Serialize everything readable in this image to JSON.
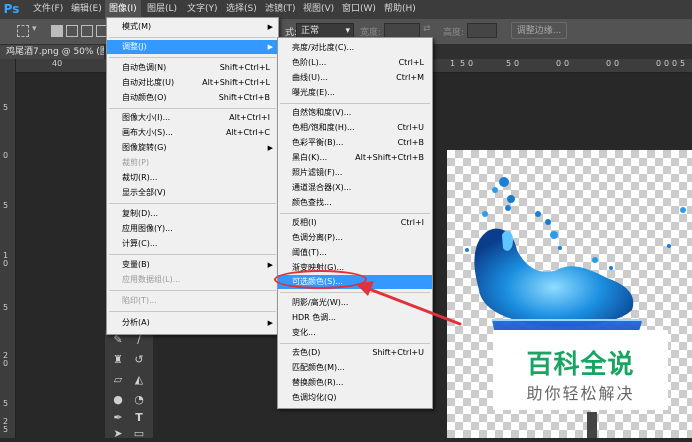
{
  "menubar": {
    "logo": "Ps",
    "items": [
      "文件(F)",
      "编辑(E)",
      "图像(I)",
      "图层(L)",
      "文字(Y)",
      "选择(S)",
      "滤镜(T)",
      "视图(V)",
      "窗口(W)",
      "帮助(H)"
    ]
  },
  "options": {
    "mode_label": "式:",
    "mode_value": "正常",
    "width_label": "宽度:",
    "height_label": "高度:",
    "refine_label": "调整边缘..."
  },
  "document": {
    "tab_title": "鸡尾酒7.png @ 50% (图层",
    "hruler_ticks": [
      "40",
      "1",
      "5",
      "0",
      "1",
      "5",
      "0",
      "5",
      "0",
      "0",
      "0",
      "0",
      "0",
      "0",
      "0",
      "0",
      "5"
    ],
    "vruler_ticks": [
      "5",
      "0",
      "5",
      "1",
      "0",
      "5",
      "2",
      "0",
      "5",
      "2",
      "5"
    ]
  },
  "image_menu": {
    "items": [
      {
        "label": "模式(M)",
        "shortcut": "",
        "arrow": true
      },
      {
        "label": "调整(J)",
        "shortcut": "",
        "arrow": true
      },
      {
        "label": "自动色调(N)",
        "shortcut": "Shift+Ctrl+L",
        "arrow": false
      },
      {
        "label": "自动对比度(U)",
        "shortcut": "Alt+Shift+Ctrl+L",
        "arrow": false
      },
      {
        "label": "自动颜色(O)",
        "shortcut": "Shift+Ctrl+B",
        "arrow": false
      },
      {
        "label": "图像大小(I)...",
        "shortcut": "Alt+Ctrl+I",
        "arrow": false
      },
      {
        "label": "画布大小(S)...",
        "shortcut": "Alt+Ctrl+C",
        "arrow": false
      },
      {
        "label": "图像旋转(G)",
        "shortcut": "",
        "arrow": true
      },
      {
        "label": "裁剪(P)",
        "shortcut": "",
        "arrow": false
      },
      {
        "label": "裁切(R)...",
        "shortcut": "",
        "arrow": false
      },
      {
        "label": "显示全部(V)",
        "shortcut": "",
        "arrow": false
      },
      {
        "label": "复制(D)...",
        "shortcut": "",
        "arrow": false
      },
      {
        "label": "应用图像(Y)...",
        "shortcut": "",
        "arrow": false
      },
      {
        "label": "计算(C)...",
        "shortcut": "",
        "arrow": false
      },
      {
        "label": "变量(B)",
        "shortcut": "",
        "arrow": true
      },
      {
        "label": "应用数据组(L)...",
        "shortcut": "",
        "arrow": false
      },
      {
        "label": "陷印(T)...",
        "shortcut": "",
        "arrow": false
      },
      {
        "label": "分析(A)",
        "shortcut": "",
        "arrow": true
      }
    ]
  },
  "adjust_menu": {
    "items": [
      {
        "label": "亮度/对比度(C)...",
        "shortcut": ""
      },
      {
        "label": "色阶(L)...",
        "shortcut": "Ctrl+L"
      },
      {
        "label": "曲线(U)...",
        "shortcut": "Ctrl+M"
      },
      {
        "label": "曝光度(E)...",
        "shortcut": ""
      },
      {
        "label": "自然饱和度(V)...",
        "shortcut": ""
      },
      {
        "label": "色相/饱和度(H)...",
        "shortcut": "Ctrl+U"
      },
      {
        "label": "色彩平衡(B)...",
        "shortcut": "Ctrl+B"
      },
      {
        "label": "黑白(K)...",
        "shortcut": "Alt+Shift+Ctrl+B"
      },
      {
        "label": "照片滤镜(F)...",
        "shortcut": ""
      },
      {
        "label": "通道混合器(X)...",
        "shortcut": ""
      },
      {
        "label": "颜色查找...",
        "shortcut": ""
      },
      {
        "label": "反相(I)",
        "shortcut": "Ctrl+I"
      },
      {
        "label": "色调分离(P)...",
        "shortcut": ""
      },
      {
        "label": "阈值(T)...",
        "shortcut": ""
      },
      {
        "label": "渐变映射(G)...",
        "shortcut": ""
      },
      {
        "label": "可选颜色(S)...",
        "shortcut": ""
      },
      {
        "label": "阴影/高光(W)...",
        "shortcut": ""
      },
      {
        "label": "HDR 色调...",
        "shortcut": ""
      },
      {
        "label": "变化...",
        "shortcut": ""
      },
      {
        "label": "去色(D)",
        "shortcut": "Shift+Ctrl+U"
      },
      {
        "label": "匹配颜色(M)...",
        "shortcut": ""
      },
      {
        "label": "替换颜色(R)...",
        "shortcut": ""
      },
      {
        "label": "色调均化(Q)",
        "shortcut": ""
      }
    ]
  },
  "watermark": {
    "title": "百科全说",
    "subtitle": "助你轻松解决"
  },
  "colors": {
    "highlight": "#3399ff",
    "annotation": "#e0313d",
    "watermark_green": "#1aa462"
  }
}
